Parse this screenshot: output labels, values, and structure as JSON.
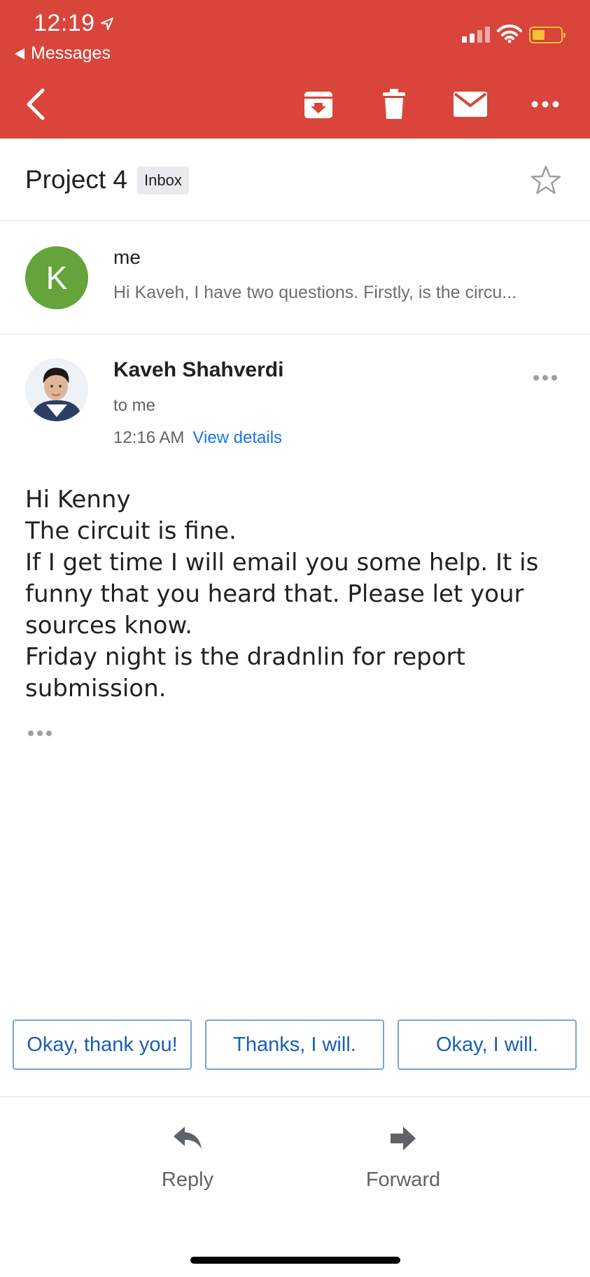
{
  "status_bar": {
    "time": "12:19",
    "back_app": "Messages"
  },
  "colors": {
    "header": "#d9453a",
    "avatar_me": "#65a33b",
    "link": "#1a73e8"
  },
  "toolbar": {
    "icons": [
      "back-arrow-icon",
      "archive-icon",
      "trash-icon",
      "mail-icon",
      "more-icon"
    ]
  },
  "thread": {
    "subject": "Project 4",
    "label": "Inbox"
  },
  "collapsed_message": {
    "avatar_letter": "K",
    "sender": "me",
    "snippet": "Hi Kaveh, I have two questions. Firstly, is the circu..."
  },
  "message": {
    "sender": "Kaveh Shahverdi",
    "recipient": "to me",
    "time": "12:16 AM",
    "view_details": "View details",
    "body": [
      "Hi Kenny",
      "The circuit is fine.",
      "If I get time I will email you some help. It is funny that you heard that. Please let your sources know.",
      "Friday night is the dradnlin for report submission."
    ]
  },
  "smart_replies": [
    "Okay, thank you!",
    "Thanks, I will.",
    "Okay, I will."
  ],
  "actions": {
    "reply": "Reply",
    "forward": "Forward"
  }
}
